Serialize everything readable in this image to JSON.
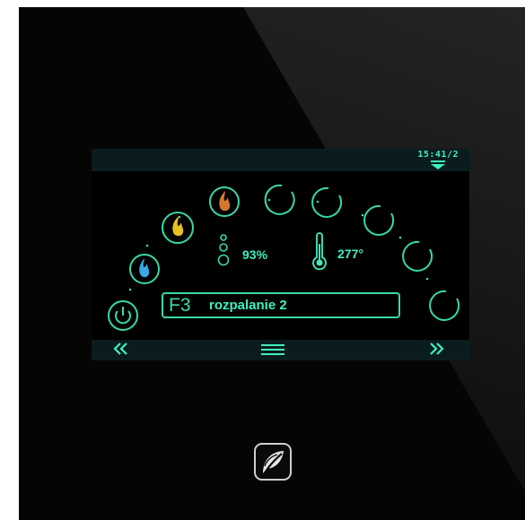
{
  "header": {
    "clock": "15:41/2",
    "dropdown_icon": "dropdown-arrow-icon"
  },
  "status": {
    "code": "F3",
    "text": "rozpalanie 2"
  },
  "stats": {
    "fan_power": "93%",
    "temperature": "277°"
  },
  "footer": {
    "prev_icon": "double-chevron-left-icon",
    "menu_icon": "hamburger-menu-icon",
    "next_icon": "double-chevron-right-icon"
  },
  "icons": {
    "power": "power-icon",
    "flame_blue": "flame-blue-icon",
    "flame_yellow": "flame-yellow-icon",
    "flame_orange": "flame-orange-icon",
    "fan": "fan-bubbles-icon",
    "thermometer": "thermometer-icon",
    "logo": "leaf-logo-icon"
  },
  "colors": {
    "accent": "#38d9a6",
    "flame_blue": "#3aa8e6",
    "flame_yellow": "#e8c020",
    "flame_orange": "#d2782c",
    "thermometer": "#3ef0c0"
  }
}
